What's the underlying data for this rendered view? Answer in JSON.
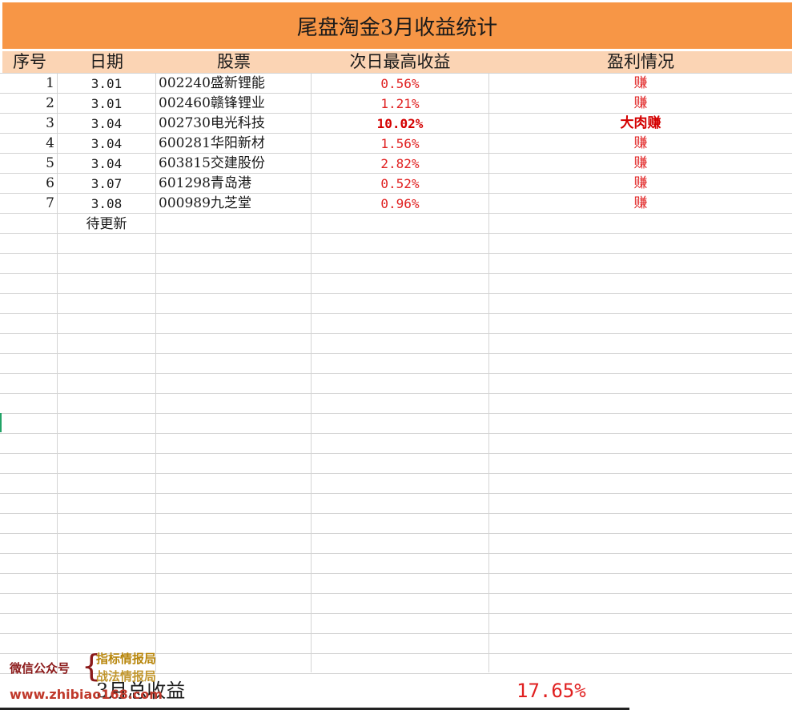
{
  "title": "尾盘淘金3月收益统计",
  "columns": {
    "seq": "序号",
    "date": "日期",
    "stock": "股票",
    "return": "次日最高收益",
    "profit": "盈利情况"
  },
  "rows": [
    {
      "seq": "1",
      "date": "3.01",
      "stock": "002240盛新锂能",
      "return": "0.56%",
      "profit": "赚",
      "highlight": false
    },
    {
      "seq": "2",
      "date": "3.01",
      "stock": "002460赣锋锂业",
      "return": "1.21%",
      "profit": "赚",
      "highlight": false
    },
    {
      "seq": "3",
      "date": "3.04",
      "stock": "002730电光科技",
      "return": "10.02%",
      "profit": "大肉赚",
      "highlight": true
    },
    {
      "seq": "4",
      "date": "3.04",
      "stock": "600281华阳新材",
      "return": "1.56%",
      "profit": "赚",
      "highlight": false
    },
    {
      "seq": "5",
      "date": "3.04",
      "stock": "603815交建股份",
      "return": "2.82%",
      "profit": "赚",
      "highlight": false
    },
    {
      "seq": "6",
      "date": "3.07",
      "stock": "601298青岛港",
      "return": "0.52%",
      "profit": "赚",
      "highlight": false
    },
    {
      "seq": "7",
      "date": "3.08",
      "stock": "000989九芝堂",
      "return": "0.96%",
      "profit": "赚",
      "highlight": false
    }
  ],
  "pending": "待更新",
  "total": {
    "label": "3月总收益",
    "value": "17.65%"
  },
  "watermark": {
    "label": "微信公众号",
    "name1": "指标情报局",
    "name2": "战法情报局",
    "url": "www.zhibiao168.com"
  },
  "colors": {
    "title_bg": "#f79646",
    "header_bg": "#fbd4b4",
    "profit_red": "#e02020",
    "grid": "#d4d4d4"
  }
}
